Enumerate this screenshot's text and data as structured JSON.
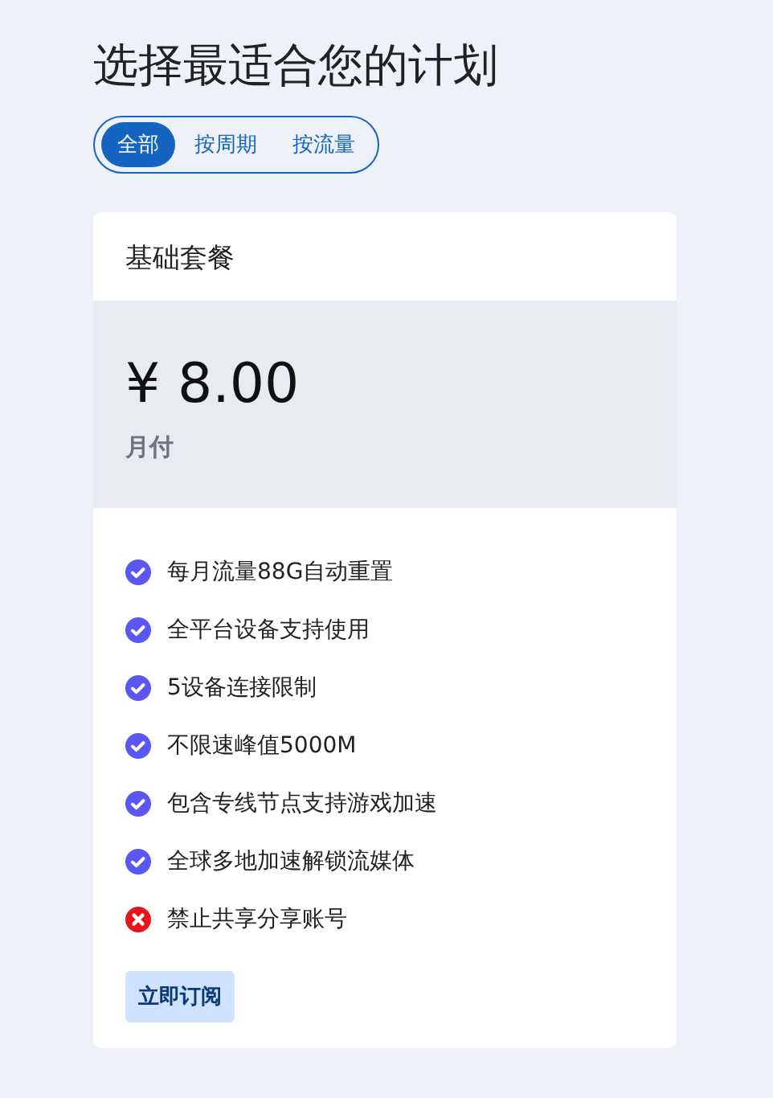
{
  "title": "选择最适合您的计划",
  "tabs": [
    {
      "label": "全部",
      "selected": true
    },
    {
      "label": "按周期",
      "selected": false
    },
    {
      "label": "按流量",
      "selected": false
    }
  ],
  "plan": {
    "name": "基础套餐",
    "price": "¥ 8.00",
    "period": "月付",
    "features": [
      {
        "text": "每月流量88G自动重置",
        "kind": "included"
      },
      {
        "text": "全平台设备支持使用",
        "kind": "included"
      },
      {
        "text": "5设备连接限制",
        "kind": "included"
      },
      {
        "text": "不限速峰值5000M",
        "kind": "included"
      },
      {
        "text": "包含专线节点支持游戏加速",
        "kind": "included"
      },
      {
        "text": "全球多地加速解锁流媒体",
        "kind": "included"
      },
      {
        "text": "禁止共享分享账号",
        "kind": "excluded"
      }
    ],
    "button": "立即订阅"
  }
}
